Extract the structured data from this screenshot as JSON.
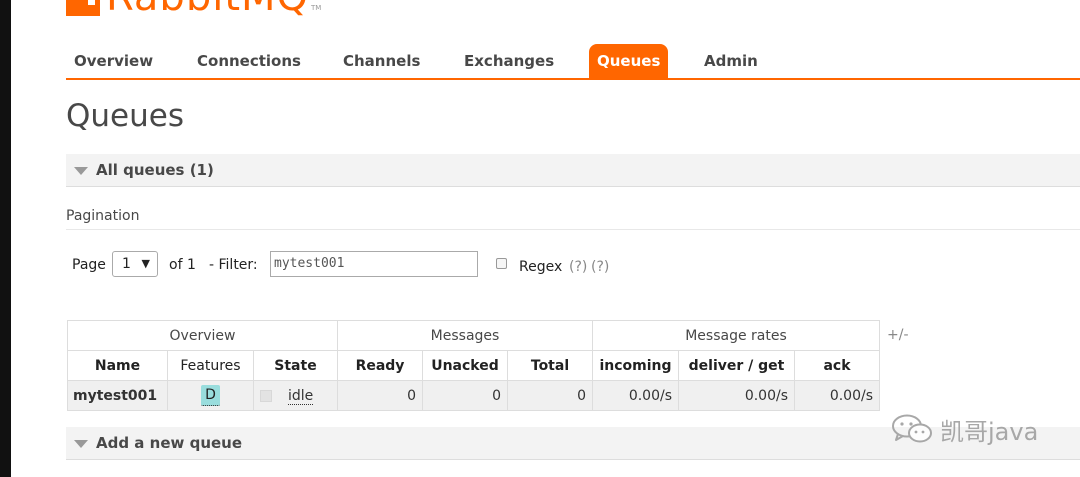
{
  "app": {
    "logo_text": "RabbitMQ",
    "logo_tm": "TM"
  },
  "nav": {
    "tabs": [
      {
        "label": "Overview",
        "active": false
      },
      {
        "label": "Connections",
        "active": false
      },
      {
        "label": "Channels",
        "active": false
      },
      {
        "label": "Exchanges",
        "active": false
      },
      {
        "label": "Queues",
        "active": true
      },
      {
        "label": "Admin",
        "active": false
      }
    ]
  },
  "page": {
    "title": "Queues"
  },
  "all_queues": {
    "label": "All queues (1)"
  },
  "pagination": {
    "label": "Pagination",
    "page_label": "Page",
    "page_value": "1",
    "of_label": "of 1",
    "filter_label": "- Filter:",
    "filter_value": "mytest001",
    "regex_label": "Regex",
    "help1": "(?)",
    "help2": "(?)"
  },
  "table": {
    "groups": [
      "Overview",
      "Messages",
      "Message rates"
    ],
    "columns": [
      "Name",
      "Features",
      "State",
      "Ready",
      "Unacked",
      "Total",
      "incoming",
      "deliver / get",
      "ack"
    ],
    "toggle": "+/-",
    "rows": [
      {
        "name": "mytest001",
        "features": "D",
        "state": "idle",
        "ready": "0",
        "unacked": "0",
        "total": "0",
        "incoming": "0.00/s",
        "deliver_get": "0.00/s",
        "ack": "0.00/s"
      }
    ]
  },
  "add_queue": {
    "label": "Add a new queue"
  },
  "watermark": {
    "text": "凯哥java"
  },
  "colors": {
    "accent": "#ff6600",
    "badge": "#99dddd"
  }
}
